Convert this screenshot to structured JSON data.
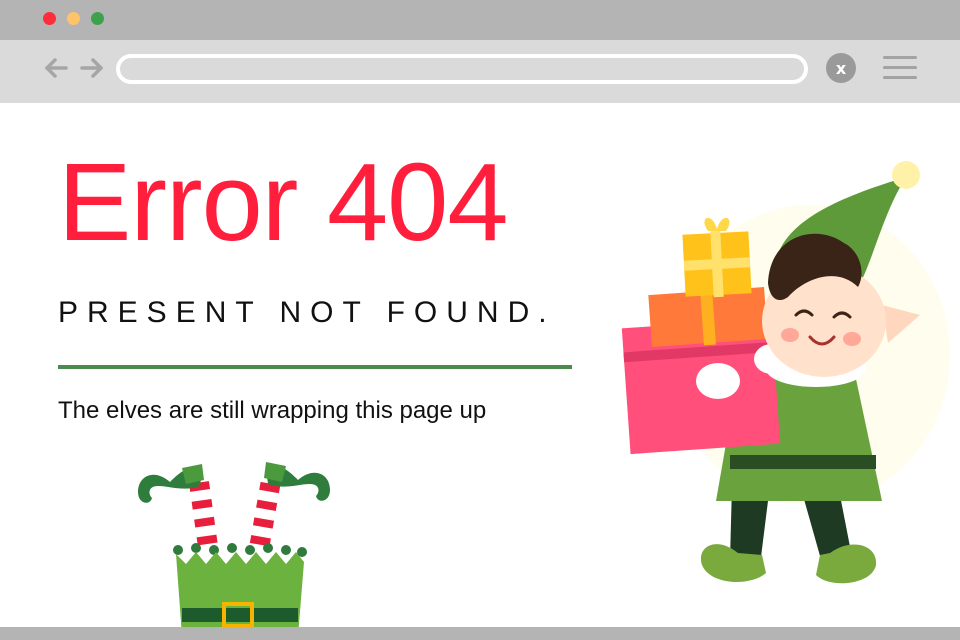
{
  "browser": {
    "window_controls": {
      "close_color": "#ff2d3b",
      "minimize_color": "#ffc46a",
      "maximize_color": "#3ea14e"
    },
    "toolbar": {
      "back_icon": "arrow-left-icon",
      "forward_icon": "arrow-right-icon",
      "address_value": "",
      "close_label": "x",
      "menu_icon": "hamburger-menu-icon"
    }
  },
  "page": {
    "heading": "Error 404",
    "subheading": "PRESENT NOT FOUND.",
    "message": "The elves are still wrapping this page up",
    "colors": {
      "heading": "#ff1f3d",
      "divider": "#4a8a4c",
      "elf_green": "#5f9a3a",
      "gift_pink": "#ff4f7a",
      "gift_orange": "#ff7a3a",
      "gift_yellow": "#ffc21a"
    }
  },
  "illustrations": {
    "elf": "elf-carrying-presents",
    "legs": "elf-legs-in-present-box"
  }
}
